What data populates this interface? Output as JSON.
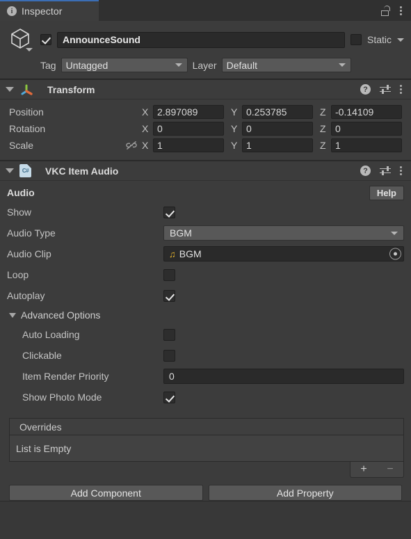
{
  "window": {
    "tab_label": "Inspector",
    "tab_icon": "info-icon",
    "lock_icon": "lock-open-icon",
    "menu_icon": "kebab-menu-icon",
    "accent_color": "#3b6eb5",
    "background_color": "#383838"
  },
  "gameobject": {
    "icon": "cube-icon",
    "enabled": true,
    "name": "AnnounceSound",
    "static_label": "Static",
    "static_checked": false,
    "tag_label": "Tag",
    "tag_value": "Untagged",
    "layer_label": "Layer",
    "layer_value": "Default"
  },
  "transform": {
    "title": "Transform",
    "icon": "transform-axis-icon",
    "expanded": true,
    "axis_labels": [
      "X",
      "Y",
      "Z"
    ],
    "rows": [
      {
        "label": "Position",
        "values": [
          "2.897089",
          "0.253785",
          "-0.14109"
        ]
      },
      {
        "label": "Rotation",
        "values": [
          "0",
          "0",
          "0"
        ]
      },
      {
        "label": "Scale",
        "values": [
          "1",
          "1",
          "1"
        ]
      }
    ],
    "scale_link_icon": "constrain-proportions-off-icon"
  },
  "vkc_item_audio": {
    "title": "VKC Item Audio",
    "icon": "csharp-script-icon",
    "expanded": true,
    "section_title": "Audio",
    "help_button": "Help",
    "fields": {
      "show_label": "Show",
      "show_checked": true,
      "audio_type_label": "Audio Type",
      "audio_type_value": "BGM",
      "audio_clip_label": "Audio Clip",
      "audio_clip_value": "BGM",
      "audio_clip_icon": "music-note-icon",
      "loop_label": "Loop",
      "loop_checked": false,
      "autoplay_label": "Autoplay",
      "autoplay_checked": true
    },
    "advanced": {
      "title": "Advanced Options",
      "expanded": true,
      "auto_loading_label": "Auto Loading",
      "auto_loading_checked": false,
      "clickable_label": "Clickable",
      "clickable_checked": false,
      "item_render_priority_label": "Item Render Priority",
      "item_render_priority_value": "0",
      "show_photo_mode_label": "Show Photo Mode",
      "show_photo_mode_checked": true
    },
    "overrides": {
      "header": "Overrides",
      "empty_text": "List is Empty",
      "add_button": "+",
      "remove_button": "−"
    }
  },
  "footer": {
    "add_component": "Add Component",
    "add_property": "Add Property"
  }
}
